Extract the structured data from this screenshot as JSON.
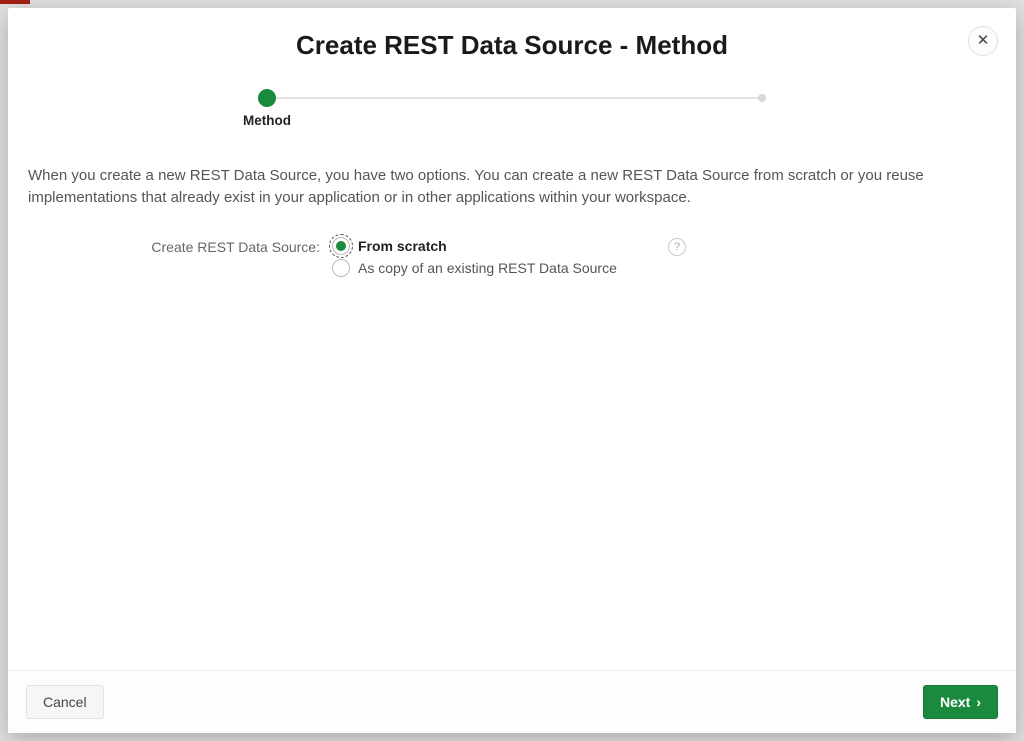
{
  "colors": {
    "accent": "#1a8a3e"
  },
  "dialog": {
    "title": "Create REST Data Source - Method",
    "close_icon": "close-icon"
  },
  "wizard": {
    "current_step_label": "Method"
  },
  "body": {
    "description": "When you create a new REST Data Source, you have two options. You can create a new REST Data Source from scratch or you reuse implementations that already exist in your application or in other applications within your workspace.",
    "field_label": "Create REST Data Source:",
    "options": [
      {
        "label": "From scratch",
        "selected": true
      },
      {
        "label": "As copy of an existing REST Data Source",
        "selected": false
      }
    ],
    "help_glyph": "?"
  },
  "footer": {
    "cancel_label": "Cancel",
    "next_label": "Next"
  }
}
